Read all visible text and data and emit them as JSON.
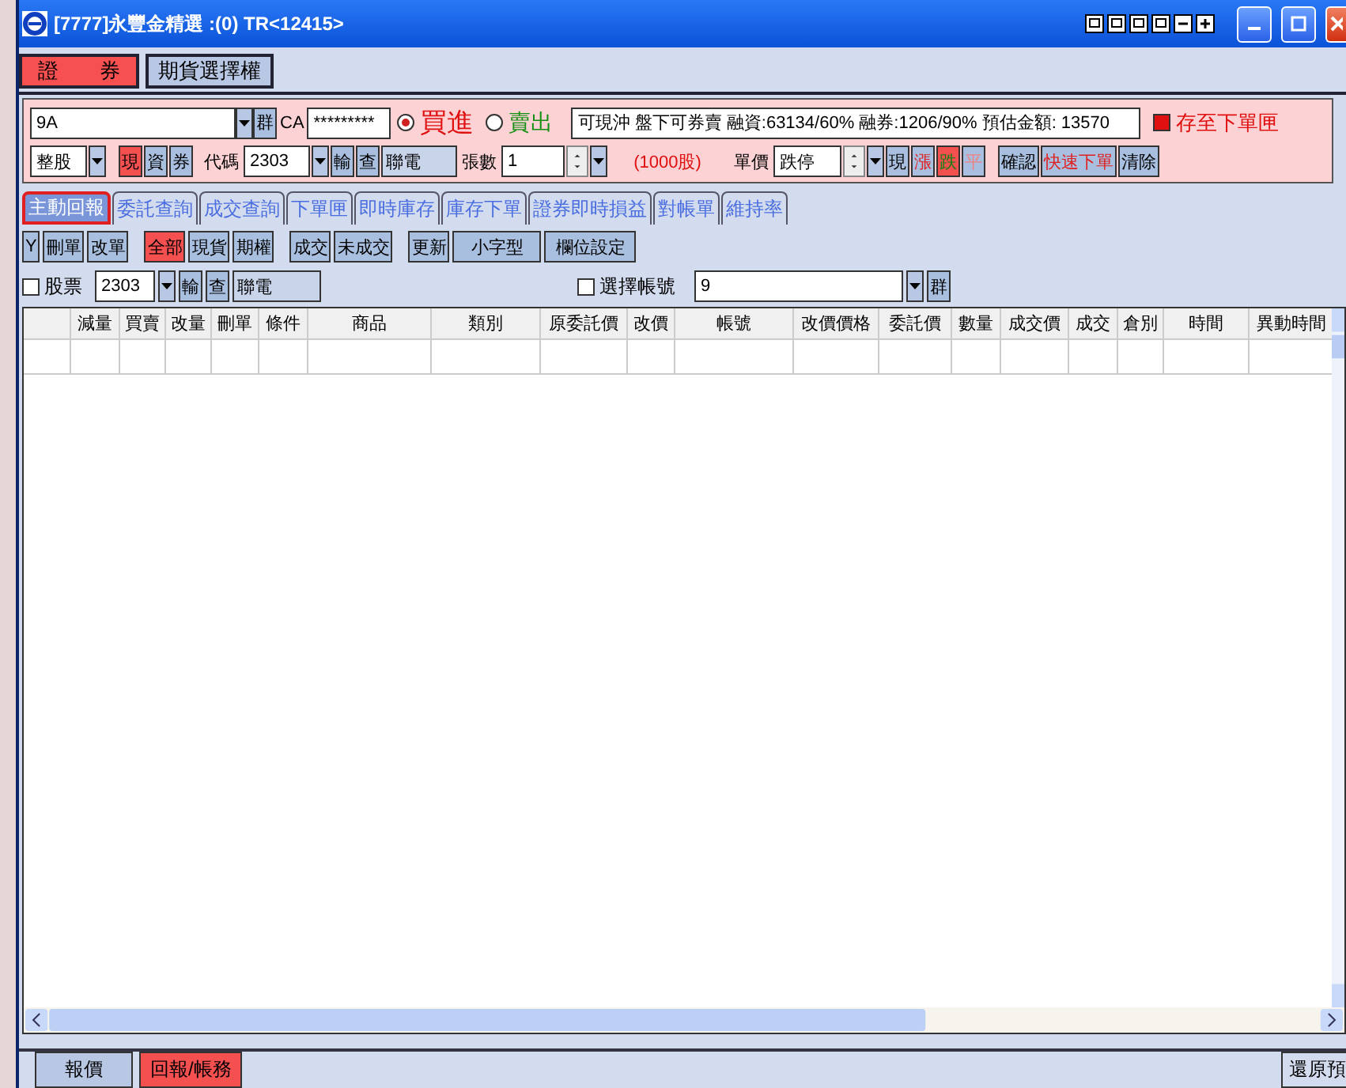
{
  "window": {
    "title": "[7777]永豐金精選 :(0) TR<12415>"
  },
  "market_tabs": [
    {
      "label": "證　　券",
      "selected": true
    },
    {
      "label": "期貨選擇權",
      "selected": false
    }
  ],
  "order": {
    "account": "9A",
    "group_button": "群",
    "ca_label": "CA",
    "password": "*********",
    "sides": [
      {
        "label": "買進",
        "selected": true
      },
      {
        "label": "賣出",
        "selected": false
      }
    ],
    "info": "可現沖 盤下可券賣 融資:63134/60% 融券:1206/90% 預估金額: 13570",
    "save_to_queue": {
      "label": "存至下單匣",
      "checked": true
    },
    "lot_type": "整股",
    "credit_types": [
      {
        "label": "現",
        "selected": true
      },
      {
        "label": "資",
        "selected": false
      },
      {
        "label": "券",
        "selected": false
      }
    ],
    "code_label": "代碼",
    "code": "2303",
    "lookup_buttons": [
      "輸",
      "查"
    ],
    "stock_name": "聯電",
    "qty_label": "張數",
    "qty": "1",
    "unit": "(1000股)",
    "price_label": "單價",
    "price": "跌停",
    "price_buttons": [
      {
        "label": "現",
        "selected": false,
        "kind": "market"
      },
      {
        "label": "漲",
        "selected": false,
        "kind": "up"
      },
      {
        "label": "跌",
        "selected": true,
        "kind": "down"
      },
      {
        "label": "平",
        "selected": false,
        "kind": "flat"
      }
    ],
    "actions": [
      {
        "label": "確認",
        "kind": "normal"
      },
      {
        "label": "快速下單",
        "kind": "quick"
      },
      {
        "label": "清除",
        "kind": "normal"
      }
    ]
  },
  "report_tabs": [
    {
      "label": "主動回報",
      "selected": true
    },
    {
      "label": "委託查詢",
      "selected": false
    },
    {
      "label": "成交查詢",
      "selected": false
    },
    {
      "label": "下單匣",
      "selected": false
    },
    {
      "label": "即時庫存",
      "selected": false
    },
    {
      "label": "庫存下單",
      "selected": false
    },
    {
      "label": "證券即時損益",
      "selected": false
    },
    {
      "label": "對帳單",
      "selected": false
    },
    {
      "label": "維持率",
      "selected": false
    }
  ],
  "order_actions": [
    "Y",
    "刪單",
    "改單"
  ],
  "product_filter": [
    {
      "label": "全部",
      "selected": true
    },
    {
      "label": "現貨",
      "selected": false
    },
    {
      "label": "期權",
      "selected": false
    }
  ],
  "deal_filter": [
    "成交",
    "未成交"
  ],
  "tools": [
    "更新",
    "小字型",
    "欄位設定"
  ],
  "stock_filter": {
    "label": "股票",
    "checked": false,
    "code": "2303",
    "buttons": [
      "輸",
      "查"
    ],
    "name": "聯電"
  },
  "account_filter": {
    "label": "選擇帳號",
    "checked": false,
    "account": "9",
    "group_button": "群"
  },
  "table": {
    "columns": [
      "減量",
      "買賣",
      "改量",
      "刪單",
      "條件",
      "商品",
      "類別",
      "原委託價",
      "改價",
      "帳號",
      "改價價格",
      "委託價",
      "數量",
      "成交價",
      "成交",
      "倉別",
      "時間",
      "異動時間"
    ]
  },
  "bottom_tabs": [
    {
      "label": "報價",
      "selected": false
    },
    {
      "label": "回報/帳務",
      "selected": true
    }
  ],
  "restore_button": "還原預"
}
